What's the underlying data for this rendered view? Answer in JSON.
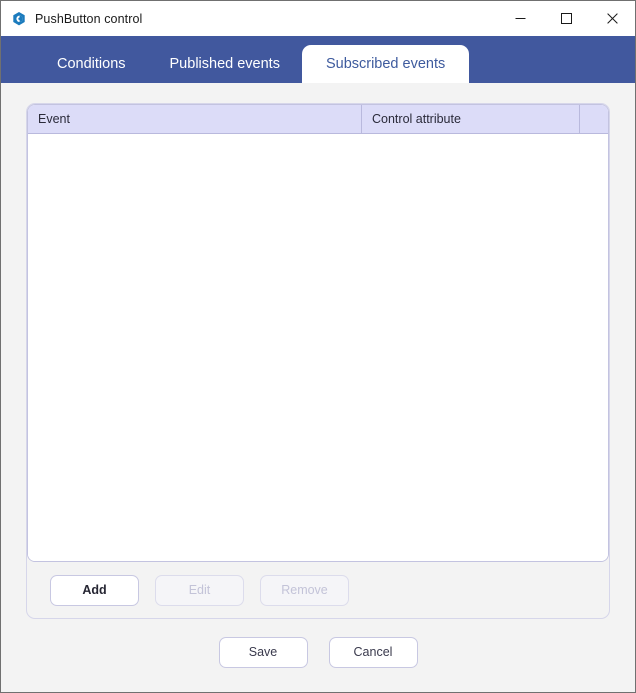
{
  "window": {
    "title": "PushButton control",
    "app_icon": "app-logo-icon",
    "controls": {
      "minimize": "minimize-icon",
      "maximize": "maximize-icon",
      "close": "close-icon"
    }
  },
  "colors": {
    "tabstrip": "#41589E",
    "active_tab_text": "#3E5B9E",
    "grid_header": "#DCDCF8",
    "content_bg": "#F3F3F3",
    "panel_border": "#D6D6EA"
  },
  "tabs": [
    {
      "label": "Conditions",
      "active": false
    },
    {
      "label": "Published events",
      "active": false
    },
    {
      "label": "Subscribed events",
      "active": true
    }
  ],
  "grid": {
    "columns": [
      {
        "label": "Event"
      },
      {
        "label": "Control attribute"
      },
      {
        "label": ""
      }
    ],
    "rows": []
  },
  "actions": {
    "add": {
      "label": "Add",
      "enabled": true
    },
    "edit": {
      "label": "Edit",
      "enabled": false
    },
    "remove": {
      "label": "Remove",
      "enabled": false
    }
  },
  "footer": {
    "save": {
      "label": "Save",
      "enabled": true
    },
    "cancel": {
      "label": "Cancel",
      "enabled": true
    }
  }
}
